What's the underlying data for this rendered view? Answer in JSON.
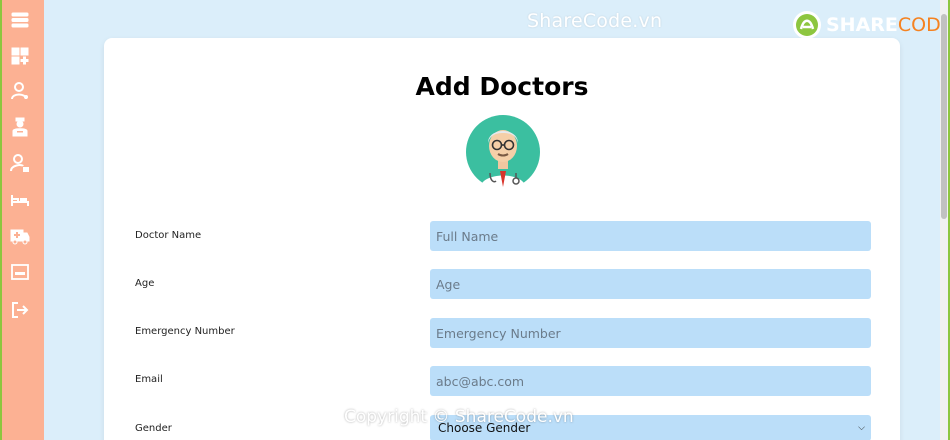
{
  "watermark": {
    "top_text": "ShareCode.vn",
    "copyright": "Copyright © ShareCode.vn"
  },
  "logo": {
    "share": "SHARE",
    "code": "CODE.vn"
  },
  "sidebar": {
    "icons": [
      "menu-icon",
      "dashboard-add-icon",
      "user-icon",
      "doctor-icon",
      "user-lock-icon",
      "bed-icon",
      "ambulance-icon",
      "room-icon",
      "logout-icon"
    ]
  },
  "form": {
    "title": "Add Doctors",
    "fields": [
      {
        "label": "Doctor Name",
        "placeholder": "Full Name"
      },
      {
        "label": "Age",
        "placeholder": "Age"
      },
      {
        "label": "Emergency Number",
        "placeholder": "Emergency Number"
      },
      {
        "label": "Email",
        "placeholder": "abc@abc.com"
      }
    ],
    "gender": {
      "label": "Gender",
      "selected": "Choose Gender"
    }
  },
  "colors": {
    "sidebar": "#fcb193",
    "background": "#dbeefa",
    "field": "#bbdef9",
    "accent": "#8dc63f"
  }
}
